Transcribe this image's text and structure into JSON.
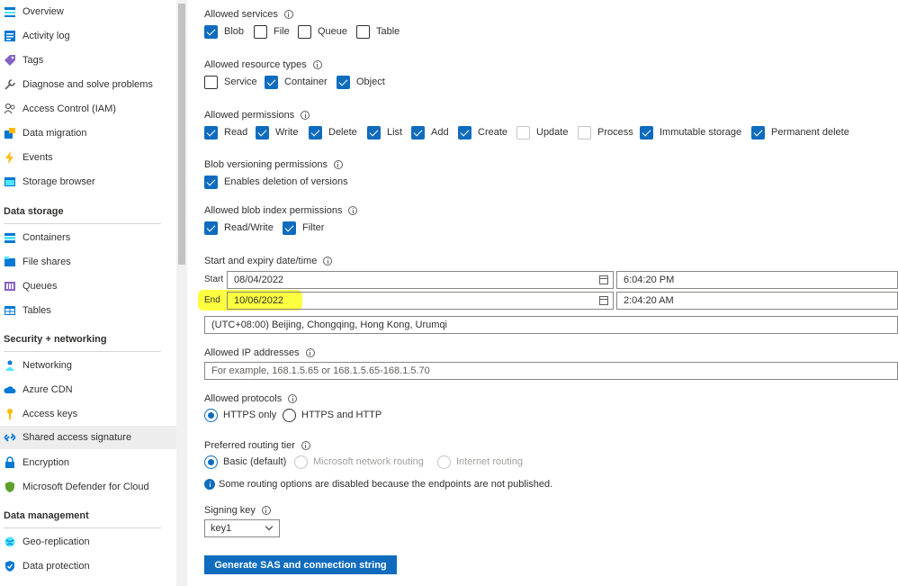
{
  "sidebar": {
    "items_top": [
      {
        "label": "Overview",
        "icon": "overview-icon"
      },
      {
        "label": "Activity log",
        "icon": "activity-log-icon"
      },
      {
        "label": "Tags",
        "icon": "tag-icon"
      },
      {
        "label": "Diagnose and solve problems",
        "icon": "wrench-icon"
      },
      {
        "label": "Access Control (IAM)",
        "icon": "people-icon"
      },
      {
        "label": "Data migration",
        "icon": "migration-icon"
      },
      {
        "label": "Events",
        "icon": "lightning-icon"
      },
      {
        "label": "Storage browser",
        "icon": "storage-browser-icon"
      }
    ],
    "sections": [
      {
        "title": "Data storage",
        "items": [
          {
            "label": "Containers",
            "icon": "containers-icon"
          },
          {
            "label": "File shares",
            "icon": "file-shares-icon"
          },
          {
            "label": "Queues",
            "icon": "queues-icon"
          },
          {
            "label": "Tables",
            "icon": "tables-icon"
          }
        ]
      },
      {
        "title": "Security + networking",
        "items": [
          {
            "label": "Networking",
            "icon": "networking-icon"
          },
          {
            "label": "Azure CDN",
            "icon": "cloud-icon"
          },
          {
            "label": "Access keys",
            "icon": "key-icon"
          },
          {
            "label": "Shared access signature",
            "icon": "link-icon",
            "selected": true
          },
          {
            "label": "Encryption",
            "icon": "lock-icon"
          },
          {
            "label": "Microsoft Defender for Cloud",
            "icon": "shield-icon"
          }
        ]
      },
      {
        "title": "Data management",
        "items": [
          {
            "label": "Geo-replication",
            "icon": "globe-icon"
          },
          {
            "label": "Data protection",
            "icon": "shield-check-icon"
          }
        ]
      }
    ]
  },
  "form": {
    "allowed_services": {
      "label": "Allowed services",
      "options": [
        {
          "label": "Blob",
          "checked": true
        },
        {
          "label": "File",
          "checked": false
        },
        {
          "label": "Queue",
          "checked": false
        },
        {
          "label": "Table",
          "checked": false
        }
      ]
    },
    "allowed_resource_types": {
      "label": "Allowed resource types",
      "options": [
        {
          "label": "Service",
          "checked": false
        },
        {
          "label": "Container",
          "checked": true
        },
        {
          "label": "Object",
          "checked": true
        }
      ]
    },
    "allowed_permissions": {
      "label": "Allowed permissions",
      "options": [
        {
          "label": "Read",
          "checked": true
        },
        {
          "label": "Write",
          "checked": true
        },
        {
          "label": "Delete",
          "checked": true
        },
        {
          "label": "List",
          "checked": true
        },
        {
          "label": "Add",
          "checked": true
        },
        {
          "label": "Create",
          "checked": true
        },
        {
          "label": "Update",
          "checked": false,
          "disabled": true
        },
        {
          "label": "Process",
          "checked": false,
          "disabled": true
        },
        {
          "label": "Immutable storage",
          "checked": true
        },
        {
          "label": "Permanent delete",
          "checked": true
        }
      ]
    },
    "blob_versioning": {
      "label": "Blob versioning permissions",
      "options": [
        {
          "label": "Enables deletion of versions",
          "checked": true
        }
      ]
    },
    "blob_index": {
      "label": "Allowed blob index permissions",
      "options": [
        {
          "label": "Read/Write",
          "checked": true
        },
        {
          "label": "Filter",
          "checked": true
        }
      ]
    },
    "expiry": {
      "label": "Start and expiry date/time",
      "start_label": "Start",
      "start_date": "08/04/2022",
      "start_time": "6:04:20 PM",
      "end_label": "End",
      "end_date": "10/06/2022",
      "end_time": "2:04:20 AM",
      "timezone": "(UTC+08:00) Beijing, Chongqing, Hong Kong, Urumqi",
      "highlight_color": "#fbff3f"
    },
    "allowed_ip": {
      "label": "Allowed IP addresses",
      "placeholder": "For example, 168.1.5.65 or 168.1.5.65-168.1.5.70"
    },
    "allowed_protocols": {
      "label": "Allowed protocols",
      "options": [
        {
          "label": "HTTPS only",
          "checked": true
        },
        {
          "label": "HTTPS and HTTP",
          "checked": false
        }
      ]
    },
    "routing_tier": {
      "label": "Preferred routing tier",
      "options": [
        {
          "label": "Basic (default)",
          "checked": true
        },
        {
          "label": "Microsoft network routing",
          "checked": false,
          "disabled": true
        },
        {
          "label": "Internet routing",
          "checked": false,
          "disabled": true
        }
      ],
      "notice": "Some routing options are disabled because the endpoints are not published."
    },
    "signing_key": {
      "label": "Signing key",
      "value": "key1"
    },
    "generate_button": "Generate SAS and connection string",
    "accent_color": "#0f6cbd"
  }
}
